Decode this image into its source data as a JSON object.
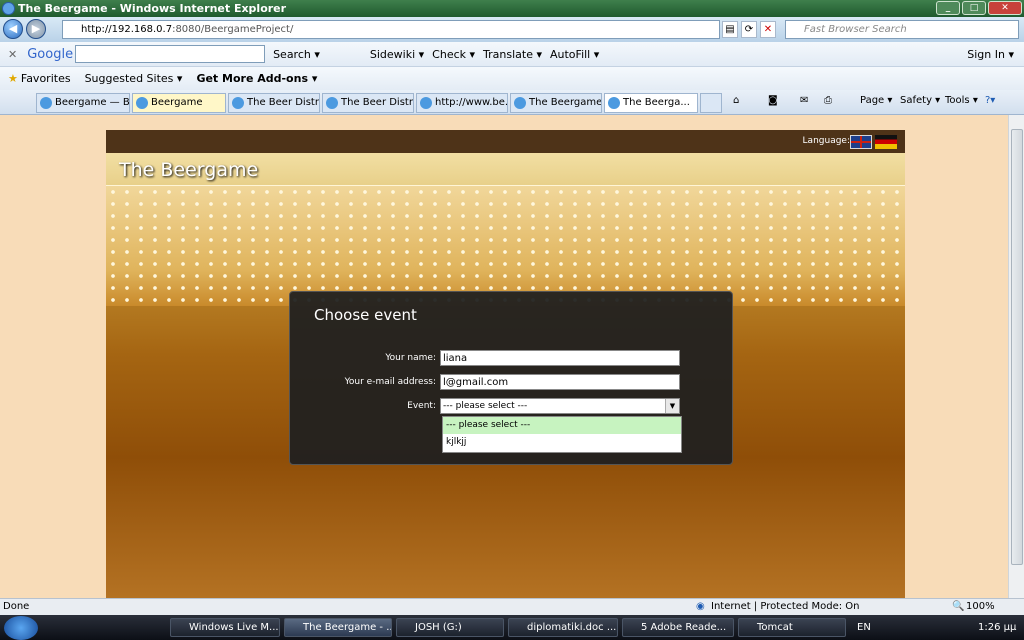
{
  "window": {
    "title": "The Beergame - Windows Internet Explorer"
  },
  "address": {
    "host": "http://192.168.0.7",
    "rest": ":8080/BeergameProject/",
    "search_placeholder": "Fast Browser Search"
  },
  "google_toolbar": {
    "logo": "Google",
    "items": [
      "Search ▾",
      "Sidewiki ▾",
      "Check ▾",
      "Translate ▾",
      "AutoFill ▾"
    ],
    "signin": "Sign In ▾"
  },
  "favorites": {
    "favorites": "Favorites",
    "suggested": "Suggested Sites ▾",
    "addons": "Get More Add-ons ▾"
  },
  "tabs": [
    "Beergame — B...",
    "Beergame",
    "The Beer Distri...",
    "The Beer Distri...",
    "http://www.be...",
    "The Beergame",
    "The Beerga..."
  ],
  "commands": [
    "Page ▾",
    "Safety ▾",
    "Tools ▾"
  ],
  "site": {
    "language_label": "Language:",
    "brand": "The Beergame"
  },
  "dialog": {
    "title": "Choose event",
    "name_label": "Your name:",
    "name_value": "liana",
    "email_label": "Your e-mail address:",
    "email_value": "l@gmail.com",
    "event_label": "Event:",
    "event_selected": "--- please select ---",
    "options": [
      "--- please select ---",
      "kjlkjj"
    ]
  },
  "status": {
    "left": "Done",
    "zone": "Internet | Protected Mode: On",
    "zoom": "100%"
  },
  "taskbar": {
    "items": [
      "Windows Live M...",
      "The Beergame - ...",
      "JOSH (G:)",
      "diplomatiki.doc ...",
      "5 Adobe Reade...",
      "Tomcat"
    ],
    "lang": "EN",
    "time": "1:26 μμ"
  }
}
